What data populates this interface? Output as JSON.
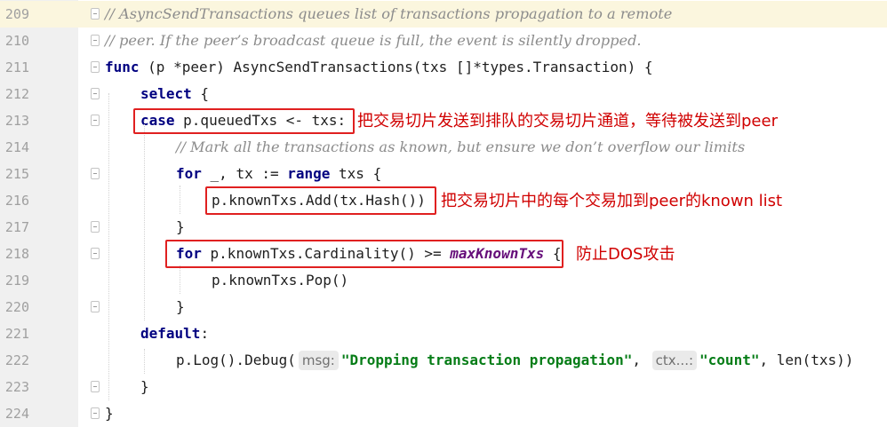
{
  "gutter": {
    "line_numbers": [
      "209",
      "210",
      "211",
      "212",
      "213",
      "214",
      "215",
      "216",
      "217",
      "218",
      "219",
      "220",
      "221",
      "222",
      "223",
      "224"
    ]
  },
  "code": {
    "l209": "// AsyncSendTransactions queues list of transactions propagation to a remote",
    "l210": "// peer. If the peer’s broadcast queue is full, the event is silently dropped.",
    "l211": {
      "kw": "func",
      "rest": " (p *peer) AsyncSendTransactions(txs []*types.Transaction) {"
    },
    "l212": {
      "kw": "select",
      "rest": " {"
    },
    "l213": {
      "kw": "case",
      "rest": " p.queuedTxs <- txs:"
    },
    "l214": "// Mark all the transactions as known, but ensure we don’t overflow our limits",
    "l215": {
      "kw1": "for",
      "mid": " _, tx := ",
      "kw2": "range",
      "rest": " txs {"
    },
    "l216": "p.knownTxs.Add(tx.Hash())",
    "l217": "}",
    "l218": {
      "kw": "for",
      "mid": " p.knownTxs.Cardinality() >= ",
      "const": "maxKnownTxs",
      "rest": " {"
    },
    "l219": "p.knownTxs.Pop()",
    "l220": "}",
    "l221": {
      "kw": "default",
      "rest": ":"
    },
    "l222": {
      "pre": "p.Log().Debug(",
      "hint1": "msg:",
      "str1": "\"Dropping transaction propagation\"",
      "sep": ", ",
      "hint2": "ctx...:",
      "str2": "\"count\"",
      "rest": ", len(txs))"
    },
    "l223": "}",
    "l224": "}"
  },
  "annotations": {
    "a213": "把交易切片发送到排队的交易切片通道，等待被发送到peer",
    "a216": "把交易切片中的每个交易加到peer的known list",
    "a218": "防止DOS攻击"
  },
  "colors": {
    "annotation_red": "#d00000",
    "keyword": "#000080",
    "string": "#067d17",
    "constant": "#660e7a",
    "comment": "#8c8c8c",
    "current_line": "#fbf6de"
  }
}
